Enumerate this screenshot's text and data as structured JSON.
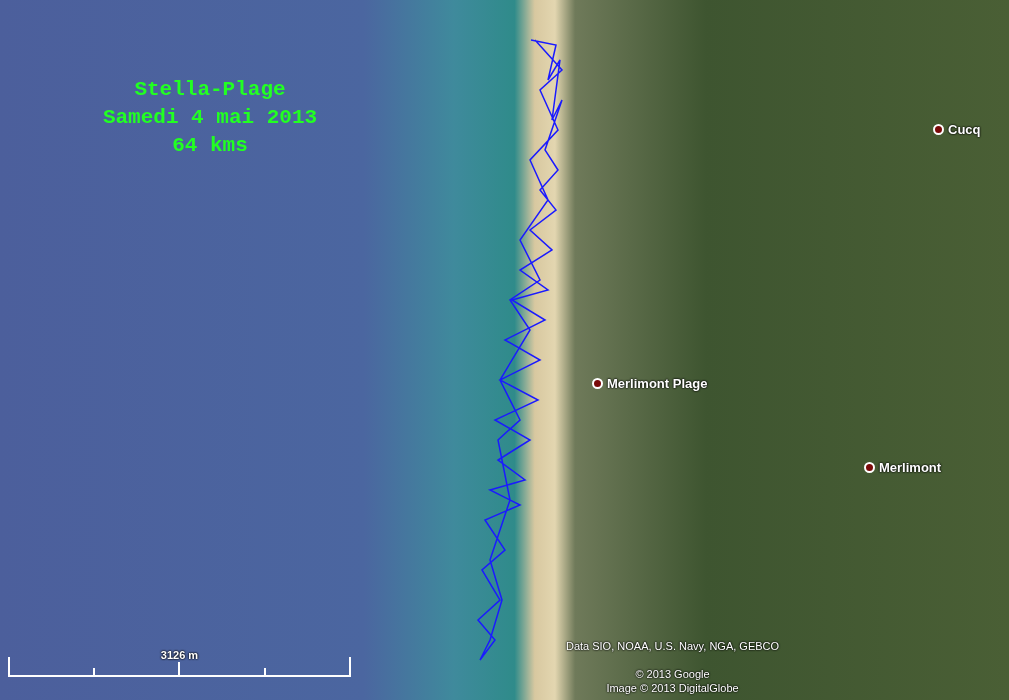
{
  "title_lines": [
    "Stella-Plage",
    "Samedi 4 mai 2013",
    "64 kms"
  ],
  "places": [
    {
      "name": "Cucq"
    },
    {
      "name": "Merlimont Plage"
    },
    {
      "name": "Merlimont"
    }
  ],
  "scale": {
    "label": "3126 m"
  },
  "attribution": {
    "data": "Data SIO, NOAA, U.S. Navy, NGA, GEBCO",
    "copyright": "© 2013 Google",
    "image": "Image © 2013 DigitalGlobe"
  }
}
